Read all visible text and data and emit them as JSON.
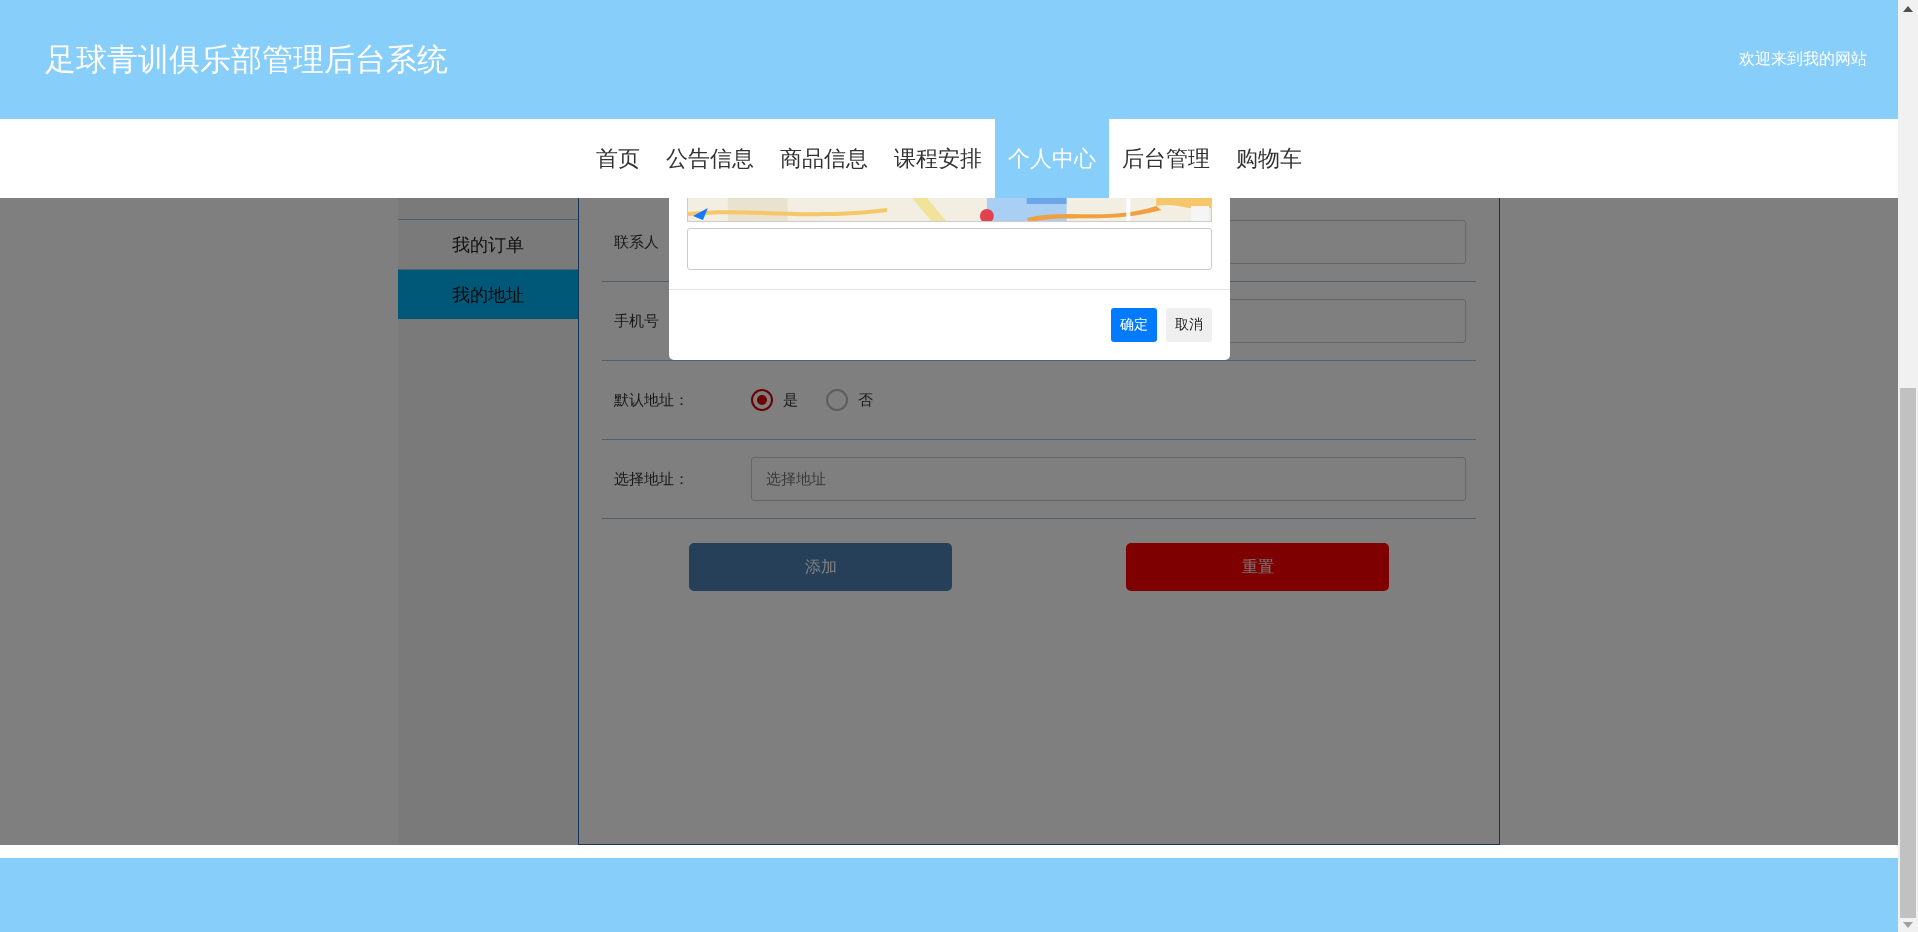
{
  "header": {
    "title": "足球青训俱乐部管理后台系统",
    "welcome": "欢迎来到我的网站"
  },
  "nav": [
    {
      "label": "首页",
      "selected": false
    },
    {
      "label": "公告信息",
      "selected": false
    },
    {
      "label": "商品信息",
      "selected": false
    },
    {
      "label": "课程安排",
      "selected": false
    },
    {
      "label": "个人中心",
      "selected": true
    },
    {
      "label": "后台管理",
      "selected": false
    },
    {
      "label": "购物车",
      "selected": false
    }
  ],
  "sidebar": [
    {
      "label": "我的订单",
      "selected": false
    },
    {
      "label": "我的地址",
      "selected": true
    }
  ],
  "form": {
    "fields": [
      {
        "kind": "text",
        "label": "联系人"
      },
      {
        "kind": "text",
        "label": "手机号"
      },
      {
        "kind": "radio",
        "label": "默认地址：",
        "options": [
          {
            "label": "是",
            "selected": true
          },
          {
            "label": "否",
            "selected": false
          }
        ]
      },
      {
        "kind": "text",
        "label": "选择地址：",
        "placeholder": "选择地址"
      }
    ],
    "buttons": [
      {
        "label": "添加",
        "kind": "primary"
      },
      {
        "label": "重置",
        "kind": "danger"
      }
    ]
  },
  "dialog": {
    "buttons": [
      {
        "label": "确定",
        "kind": "primary"
      },
      {
        "label": "取消",
        "kind": "default"
      }
    ]
  }
}
